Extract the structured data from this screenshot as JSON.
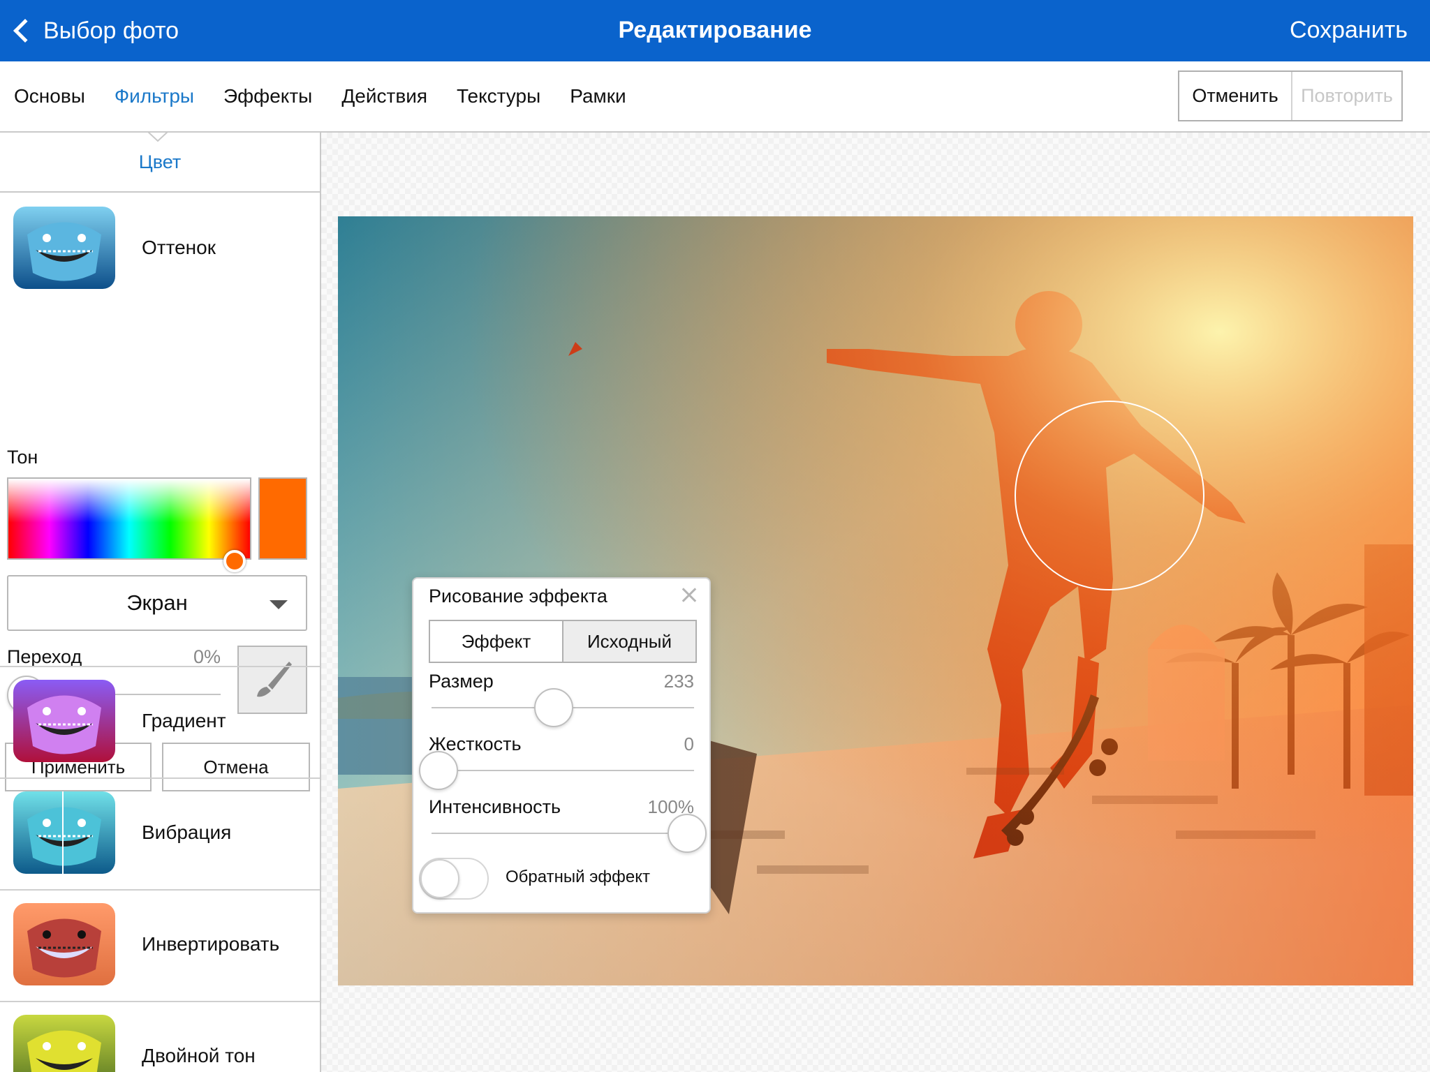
{
  "nav": {
    "back_label": "Выбор фото",
    "title": "Редактирование",
    "save_label": "Сохранить"
  },
  "tabs": [
    {
      "label": "Основы",
      "active": false
    },
    {
      "label": "Фильтры",
      "active": true
    },
    {
      "label": "Эффекты",
      "active": false
    },
    {
      "label": "Действия",
      "active": false
    },
    {
      "label": "Текстуры",
      "active": false
    },
    {
      "label": "Рамки",
      "active": false
    }
  ],
  "history": {
    "undo_label": "Отменить",
    "redo_label": "Повторить"
  },
  "panel": {
    "category": "Цвет",
    "filters": [
      {
        "label": "Оттенок",
        "icon": "shark-icon"
      },
      {
        "label": "Градиент",
        "icon": "shark-gradient-icon"
      },
      {
        "label": "Вибрация",
        "icon": "shark-vibrance-icon"
      },
      {
        "label": "Инвертировать",
        "icon": "shark-invert-icon"
      },
      {
        "label": "Двойной тон",
        "icon": "shark-duotone-icon"
      }
    ],
    "tone_label": "Тон",
    "selected_color": "#ff6a00",
    "blend_mode": "Экран",
    "transition_label": "Переход",
    "transition_value": "0%",
    "apply_label": "Применить",
    "cancel_label": "Отмена"
  },
  "paint_popup": {
    "title": "Рисование эффекта",
    "segments": [
      "Эффект",
      "Исходный"
    ],
    "active_segment": "Эффект",
    "size_label": "Размер",
    "size_value": "233",
    "hardness_label": "Жесткость",
    "hardness_value": "0",
    "intensity_label": "Интенсивность",
    "intensity_value": "100%",
    "reverse_label": "Обратный эффект",
    "reverse_on": false
  },
  "colors": {
    "nav_bar": "#0a63cc",
    "accent": "#1a78c9",
    "filter_tint": "#ff6a00"
  }
}
